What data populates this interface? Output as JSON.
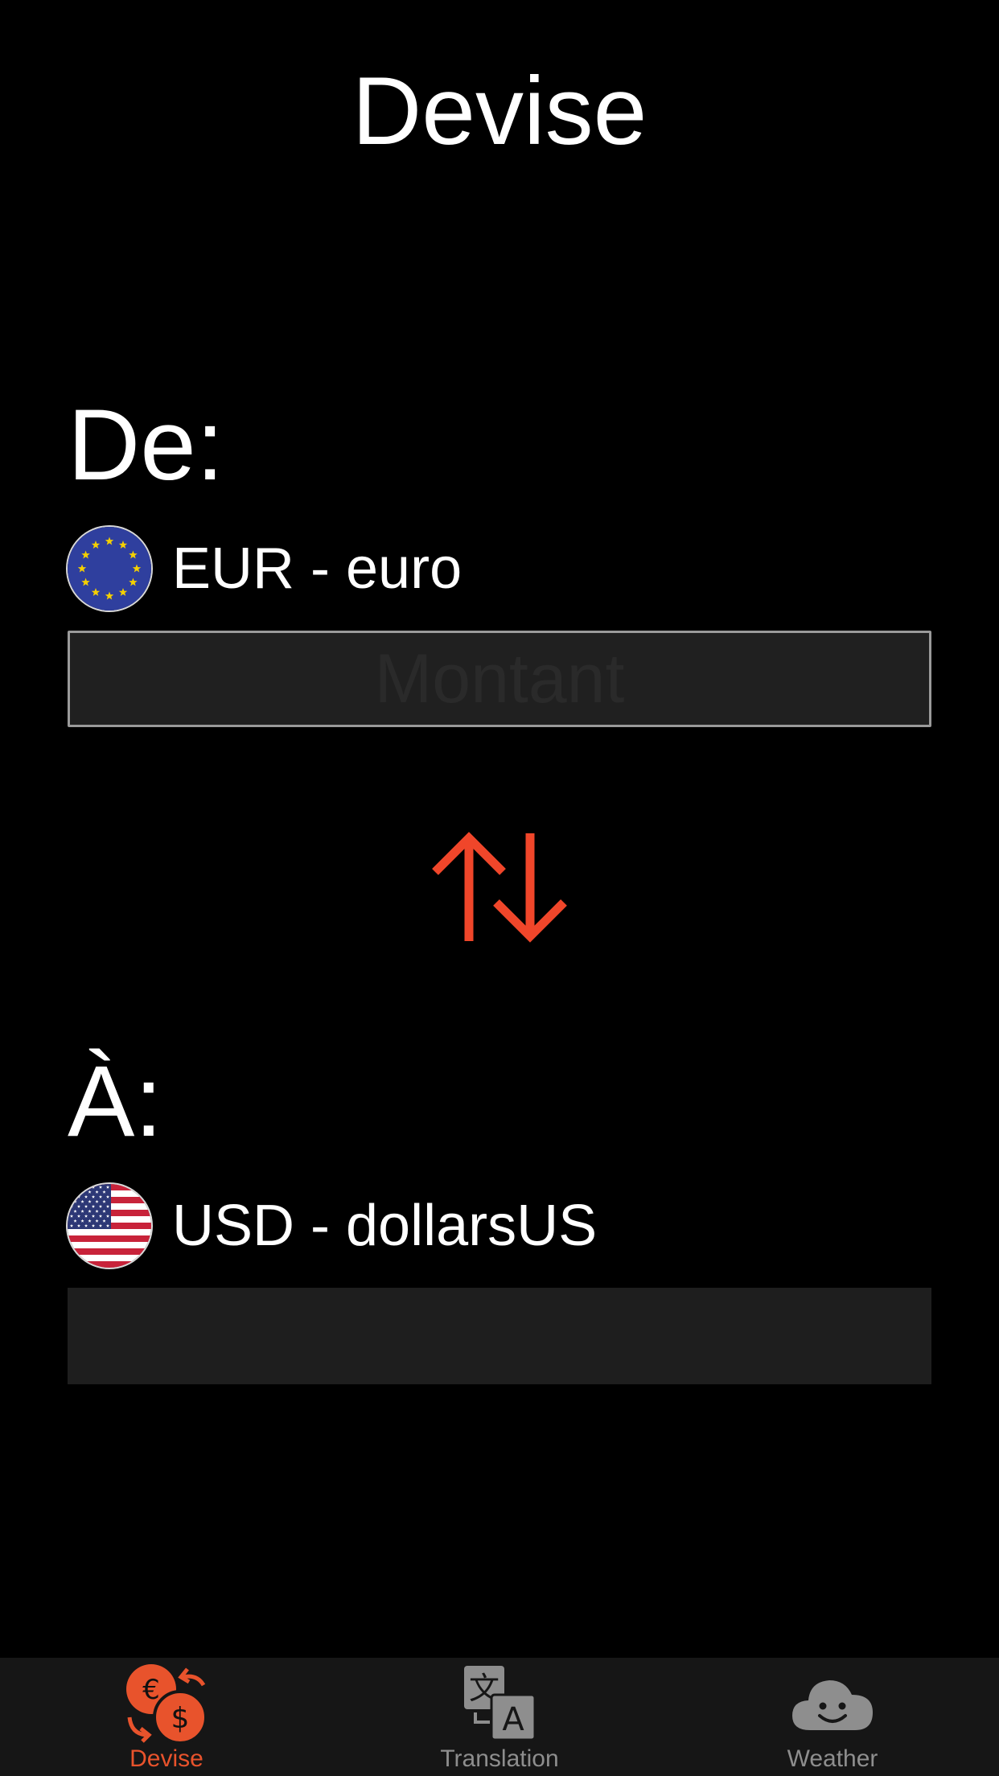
{
  "header": {
    "title": "Devise"
  },
  "converter": {
    "from_label": "De:",
    "to_label": "À:",
    "from_currency": {
      "label": "EUR - euro",
      "flag_icon": "eu-flag-icon"
    },
    "to_currency": {
      "label": "USD - dollarsUS",
      "flag_icon": "us-flag-icon"
    },
    "amount_input": {
      "value": "",
      "placeholder": "Montant"
    },
    "result_value": "",
    "swap_icon": "swap-arrows-icon"
  },
  "tab_bar": {
    "items": [
      {
        "label": "Devise",
        "icon": "currency-exchange-icon",
        "selected": true
      },
      {
        "label": "Translation",
        "icon": "translate-icon",
        "selected": false
      },
      {
        "label": "Weather",
        "icon": "cloud-smile-icon",
        "selected": false
      }
    ]
  },
  "colors": {
    "accent": "#e8532c",
    "swap": "#f0462a",
    "background": "#000000",
    "field_background": "#202020",
    "tab_inactive": "#8e8e8e",
    "tab_bar_background": "#161616"
  }
}
